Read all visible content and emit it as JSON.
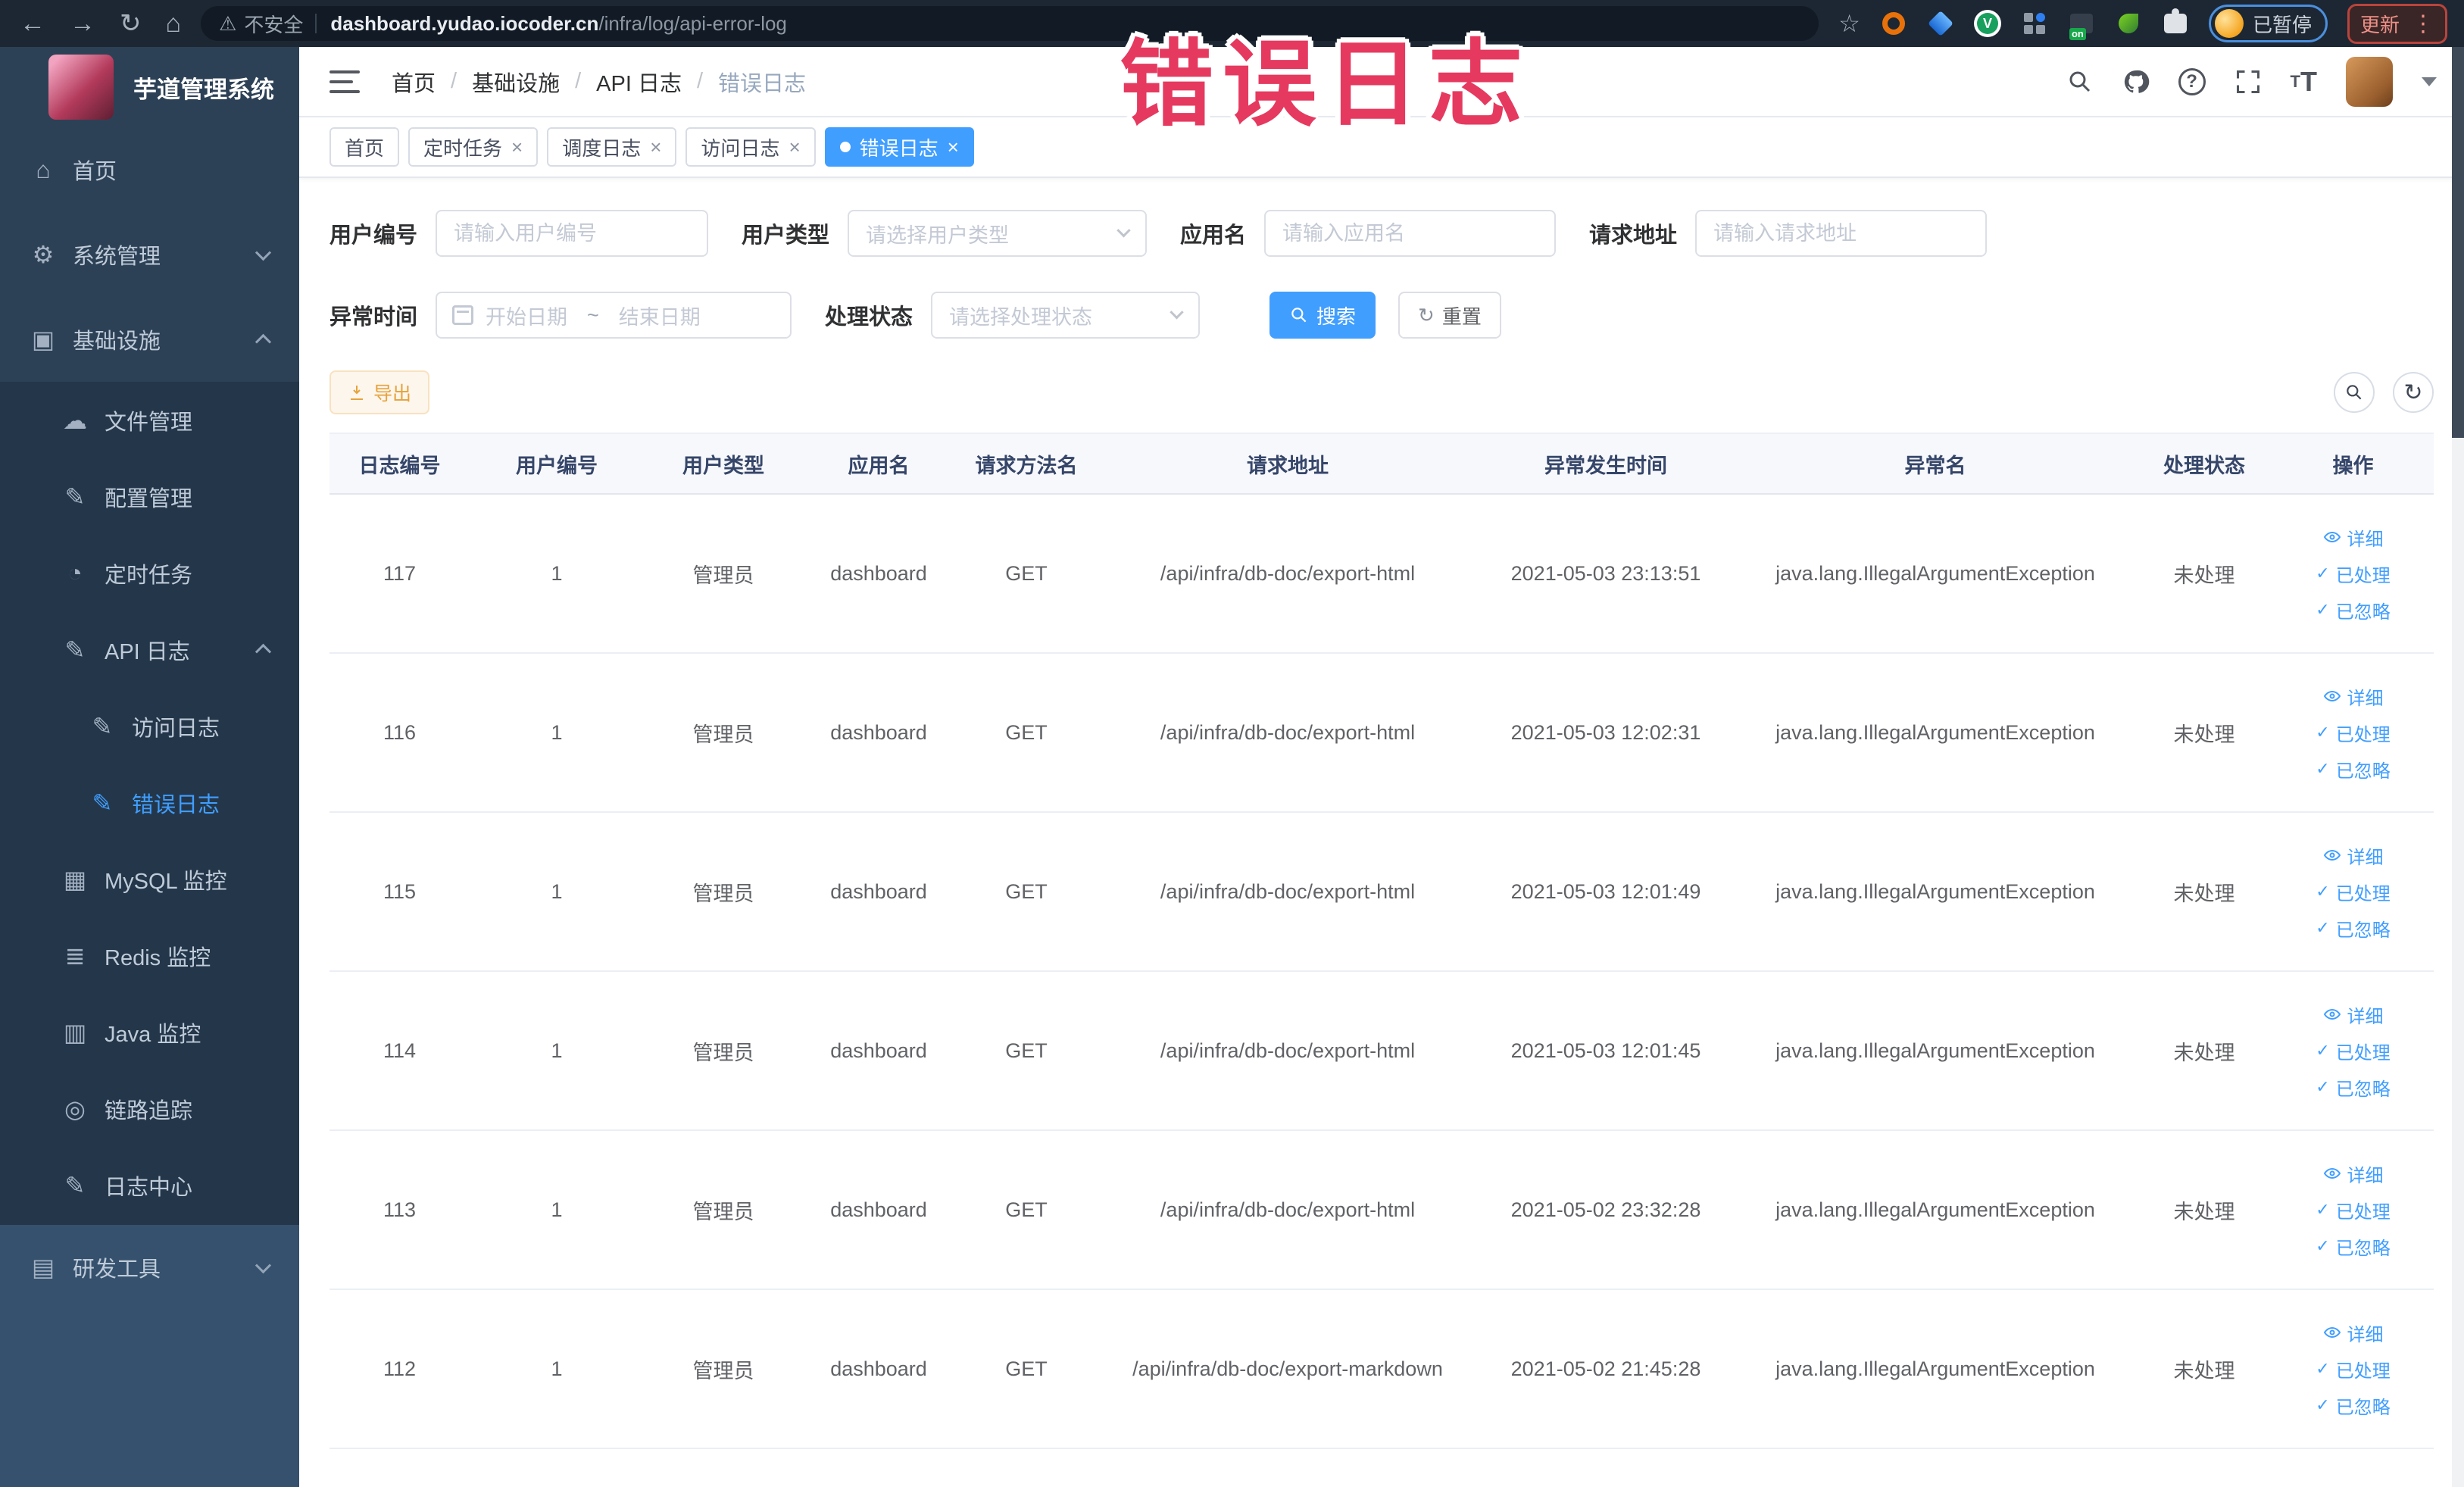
{
  "browser": {
    "security_label": "不安全",
    "url_domain": "dashboard.yudao.iocoder.cn",
    "url_path": "/infra/log/api-error-log",
    "paused_badge_label": "已暂停",
    "update_button_label": "更新"
  },
  "overlay": {
    "text": "错误日志",
    "color": "#e6395f"
  },
  "sidebar": {
    "title": "芋道管理系统",
    "items": [
      {
        "name": "home",
        "label": "首页",
        "icon": "home-icon",
        "level": 0,
        "section": "top"
      },
      {
        "name": "system-management",
        "label": "系统管理",
        "icon": "gear-icon",
        "level": 0,
        "section": "top",
        "chevron": "down"
      },
      {
        "name": "infrastructure",
        "label": "基础设施",
        "icon": "monitor-icon",
        "level": 0,
        "section": "top",
        "chevron": "up"
      },
      {
        "name": "file-management",
        "label": "文件管理",
        "icon": "cloud-icon",
        "level": 1,
        "section": "sub"
      },
      {
        "name": "config-management",
        "label": "配置管理",
        "icon": "edit-icon",
        "level": 1,
        "section": "sub"
      },
      {
        "name": "scheduled-tasks",
        "label": "定时任务",
        "icon": "timer-icon",
        "level": 1,
        "section": "sub"
      },
      {
        "name": "api-logs",
        "label": "API 日志",
        "icon": "log-icon",
        "level": 1,
        "section": "sub",
        "chevron": "up"
      },
      {
        "name": "access-logs",
        "label": "访问日志",
        "icon": "log-icon",
        "level": 2,
        "section": "sub"
      },
      {
        "name": "error-logs",
        "label": "错误日志",
        "icon": "log-icon",
        "level": 2,
        "section": "sub",
        "active": true
      },
      {
        "name": "mysql-monitor",
        "label": "MySQL 监控",
        "icon": "chart-icon",
        "level": 1,
        "section": "sub"
      },
      {
        "name": "redis-monitor",
        "label": "Redis 监控",
        "icon": "layers-icon",
        "level": 1,
        "section": "sub"
      },
      {
        "name": "java-monitor",
        "label": "Java 监控",
        "icon": "java-icon",
        "level": 1,
        "section": "sub"
      },
      {
        "name": "trace",
        "label": "链路追踪",
        "icon": "trace-icon",
        "level": 1,
        "section": "sub"
      },
      {
        "name": "log-center",
        "label": "日志中心",
        "icon": "log-icon",
        "level": 1,
        "section": "sub"
      },
      {
        "name": "dev-tools",
        "label": "研发工具",
        "icon": "toolbox-icon",
        "level": 0,
        "section": "bottom",
        "chevron": "down"
      }
    ]
  },
  "breadcrumb": [
    "首页",
    "基础设施",
    "API 日志",
    "错误日志"
  ],
  "tabs": [
    {
      "name": "home",
      "label": "首页",
      "closable": false,
      "active": false
    },
    {
      "name": "scheduled-tasks",
      "label": "定时任务",
      "closable": true,
      "active": false
    },
    {
      "name": "schedule-logs",
      "label": "调度日志",
      "closable": true,
      "active": false
    },
    {
      "name": "access-logs",
      "label": "访问日志",
      "closable": true,
      "active": false
    },
    {
      "name": "error-logs",
      "label": "错误日志",
      "closable": true,
      "active": true
    }
  ],
  "filter": {
    "user_id": {
      "label": "用户编号",
      "placeholder": "请输入用户编号"
    },
    "user_type": {
      "label": "用户类型",
      "placeholder": "请选择用户类型"
    },
    "app_name": {
      "label": "应用名",
      "placeholder": "请输入应用名"
    },
    "request_url": {
      "label": "请求地址",
      "placeholder": "请输入请求地址"
    },
    "exception_time": {
      "label": "异常时间",
      "start_placeholder": "开始日期",
      "separator": "~",
      "end_placeholder": "结束日期"
    },
    "process_status": {
      "label": "处理状态",
      "placeholder": "请选择处理状态"
    },
    "search_label": "搜索",
    "reset_label": "重置"
  },
  "toolbar": {
    "export_label": "导出"
  },
  "table": {
    "columns": [
      "日志编号",
      "用户编号",
      "用户类型",
      "应用名",
      "请求方法名",
      "请求地址",
      "异常发生时间",
      "异常名",
      "处理状态",
      "操作"
    ],
    "row_actions": [
      "详细",
      "已处理",
      "已忽略"
    ],
    "rows": [
      {
        "id": "117",
        "user_id": "1",
        "user_type": "管理员",
        "app": "dashboard",
        "method": "GET",
        "url": "/api/infra/db-doc/export-html",
        "time": "2021-05-03 23:13:51",
        "exception": "java.lang.IllegalArgumentException",
        "status": "未处理"
      },
      {
        "id": "116",
        "user_id": "1",
        "user_type": "管理员",
        "app": "dashboard",
        "method": "GET",
        "url": "/api/infra/db-doc/export-html",
        "time": "2021-05-03 12:02:31",
        "exception": "java.lang.IllegalArgumentException",
        "status": "未处理"
      },
      {
        "id": "115",
        "user_id": "1",
        "user_type": "管理员",
        "app": "dashboard",
        "method": "GET",
        "url": "/api/infra/db-doc/export-html",
        "time": "2021-05-03 12:01:49",
        "exception": "java.lang.IllegalArgumentException",
        "status": "未处理"
      },
      {
        "id": "114",
        "user_id": "1",
        "user_type": "管理员",
        "app": "dashboard",
        "method": "GET",
        "url": "/api/infra/db-doc/export-html",
        "time": "2021-05-03 12:01:45",
        "exception": "java.lang.IllegalArgumentException",
        "status": "未处理"
      },
      {
        "id": "113",
        "user_id": "1",
        "user_type": "管理员",
        "app": "dashboard",
        "method": "GET",
        "url": "/api/infra/db-doc/export-html",
        "time": "2021-05-02 23:32:28",
        "exception": "java.lang.IllegalArgumentException",
        "status": "未处理"
      },
      {
        "id": "112",
        "user_id": "1",
        "user_type": "管理员",
        "app": "dashboard",
        "method": "GET",
        "url": "/api/infra/db-doc/export-markdown",
        "time": "2021-05-02 21:45:28",
        "exception": "java.lang.IllegalArgumentException",
        "status": "未处理"
      }
    ]
  },
  "colors": {
    "accent": "#409eff",
    "export_accent": "#e6a23c",
    "overlay_red": "#e6395f",
    "sidebar_bg": "#2d4156"
  }
}
